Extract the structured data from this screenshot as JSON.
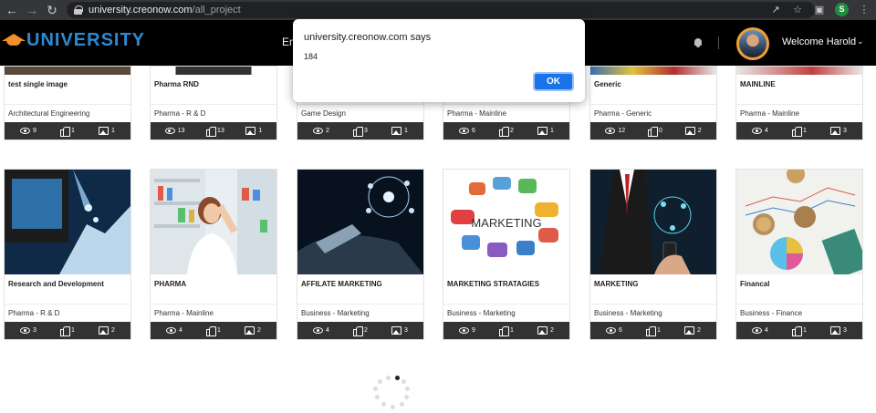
{
  "browser": {
    "url_host": "university.creonow.com",
    "url_path": "/all_project",
    "profile_initial": "S"
  },
  "header": {
    "logo_text": "UNIVERSITY",
    "menu_peek": "En",
    "welcome": "Welcome Harold"
  },
  "dialog": {
    "title": "university.creonow.com says",
    "message": "184",
    "ok_label": "OK"
  },
  "row1": [
    {
      "title": "test single image",
      "category": "Architectural Engineering",
      "views": "9",
      "likes": "1",
      "images": "1"
    },
    {
      "title": "Pharma RND",
      "category": "Pharma - R & D",
      "views": "13",
      "likes": "13",
      "images": "1"
    },
    {
      "title": "",
      "category": "Game Design",
      "views": "2",
      "likes": "3",
      "images": "1"
    },
    {
      "title": "",
      "category": "Pharma - Mainline",
      "views": "6",
      "likes": "2",
      "images": "1"
    },
    {
      "title": "Generic",
      "category": "Pharma - Generic",
      "views": "12",
      "likes": "0",
      "images": "2"
    },
    {
      "title": "MAINLINE",
      "category": "Pharma - Mainline",
      "views": "4",
      "likes": "1",
      "images": "3"
    }
  ],
  "row2": [
    {
      "title": "Research and Development",
      "category": "Pharma - R & D",
      "views": "3",
      "likes": "1",
      "images": "2"
    },
    {
      "title": "PHARMA",
      "category": "Pharma - Mainline",
      "views": "4",
      "likes": "1",
      "images": "2"
    },
    {
      "title": "AFFILATE MARKETING",
      "category": "Business - Marketing",
      "views": "4",
      "likes": "2",
      "images": "3"
    },
    {
      "title": "MARKETING STRATAGIES",
      "category": "Business - Marketing",
      "views": "9",
      "likes": "1",
      "images": "2"
    },
    {
      "title": "MARKETING",
      "category": "Business - Marketing",
      "views": "6",
      "likes": "1",
      "images": "2"
    },
    {
      "title": "Financal",
      "category": "Business - Finance",
      "views": "4",
      "likes": "1",
      "images": "3"
    }
  ],
  "thumb_art": {
    "marketing_word": "MARKETING"
  }
}
